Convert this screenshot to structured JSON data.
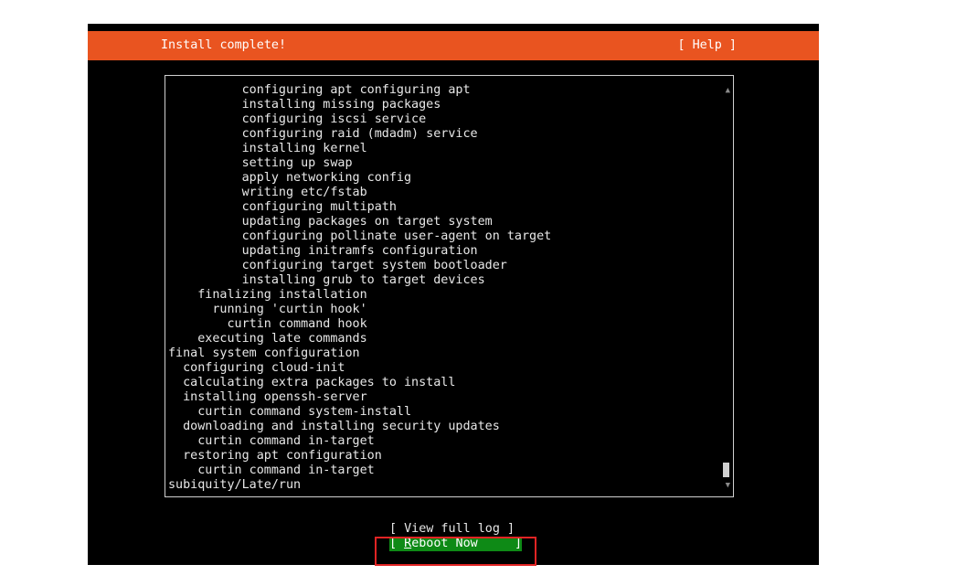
{
  "header": {
    "title": "Install complete!",
    "help_label": "[ Help ]"
  },
  "log": {
    "lines": [
      "          configuring apt configuring apt",
      "          installing missing packages",
      "          configuring iscsi service",
      "          configuring raid (mdadm) service",
      "          installing kernel",
      "          setting up swap",
      "          apply networking config",
      "          writing etc/fstab",
      "          configuring multipath",
      "          updating packages on target system",
      "          configuring pollinate user-agent on target",
      "          updating initramfs configuration",
      "          configuring target system bootloader",
      "          installing grub to target devices",
      "    finalizing installation",
      "      running 'curtin hook'",
      "        curtin command hook",
      "    executing late commands",
      "final system configuration",
      "  configuring cloud-init",
      "  calculating extra packages to install",
      "  installing openssh-server",
      "    curtin command system-install",
      "  downloading and installing security updates",
      "    curtin command in-target",
      "  restoring apt configuration",
      "    curtin command in-target",
      "subiquity/Late/run"
    ],
    "scroll_up": "▲",
    "scroll_down": "▼"
  },
  "buttons": {
    "view_log": "[ View full log ]",
    "reboot_open": "[ ",
    "reboot_mnemonic": "R",
    "reboot_rest": "eboot Now     ]"
  }
}
